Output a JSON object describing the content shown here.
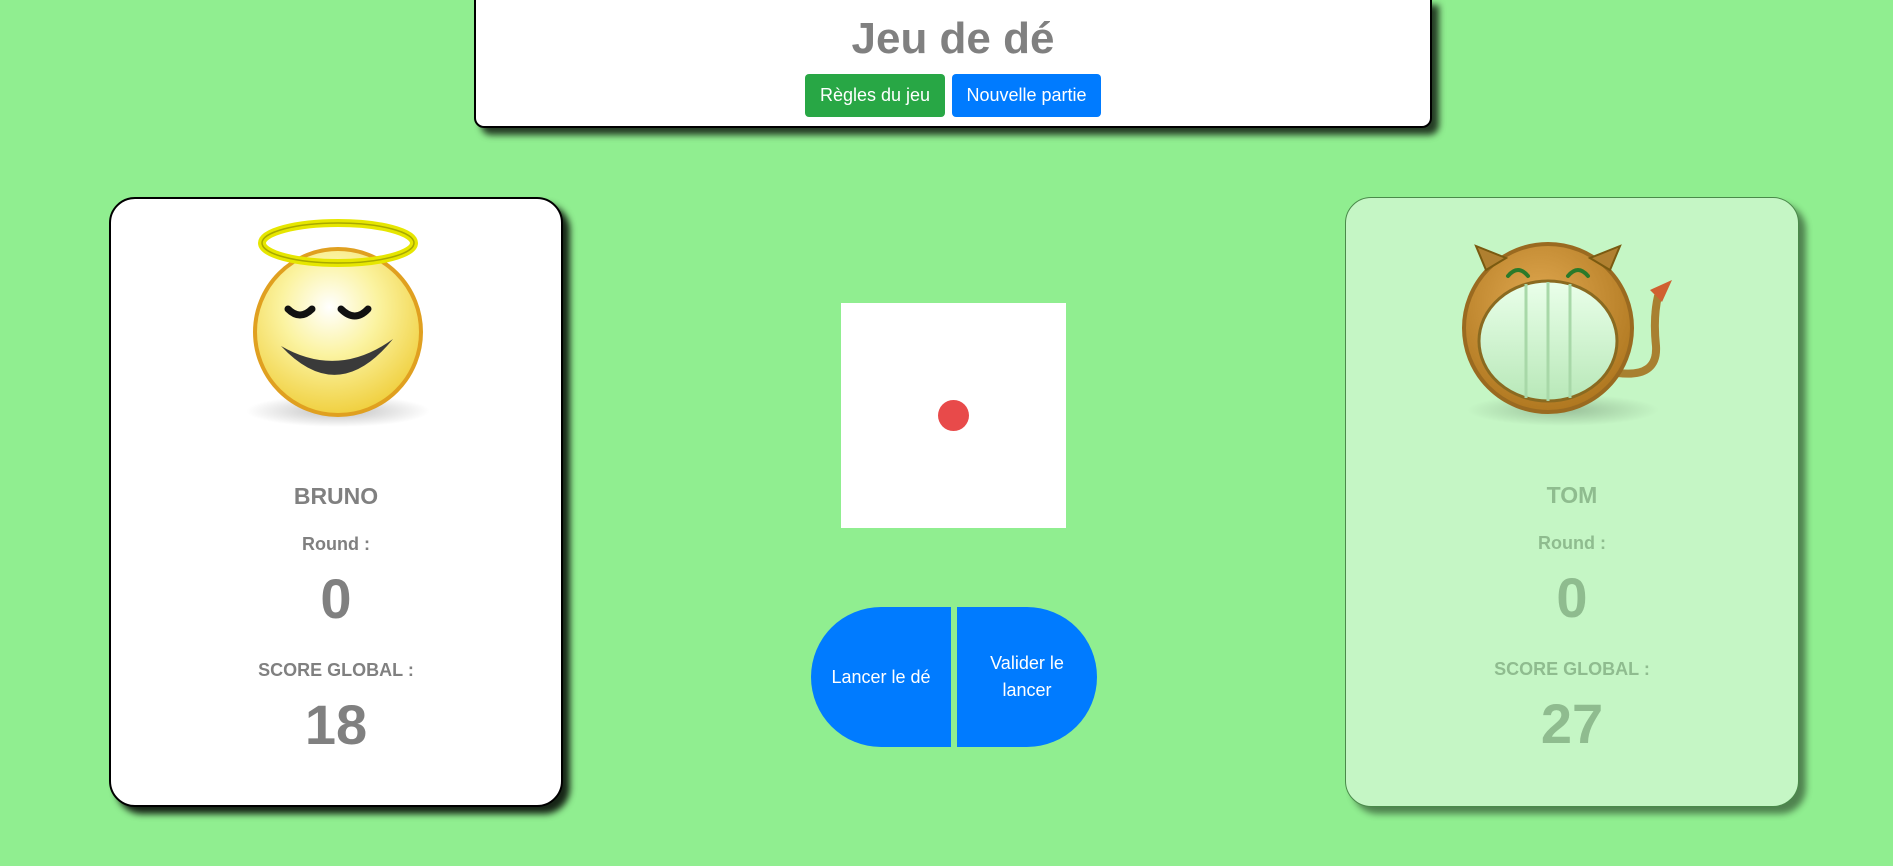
{
  "header": {
    "title": "Jeu de dé",
    "rules_button": "Règles du jeu",
    "new_game_button": "Nouvelle partie"
  },
  "players": [
    {
      "name": "BRUNO",
      "avatar": "angel-smiley-icon",
      "round_label": "Round :",
      "round_score": "0",
      "global_label": "SCORE GLOBAL :",
      "global_score": "18",
      "active": true
    },
    {
      "name": "TOM",
      "avatar": "devil-smiley-icon",
      "round_label": "Round :",
      "round_score": "0",
      "global_label": "SCORE GLOBAL :",
      "global_score": "27",
      "active": false
    }
  ],
  "die": {
    "face": 1,
    "pip_color": "#e84a4a"
  },
  "actions": {
    "roll_label": "Lancer le dé",
    "hold_label": "Valider le lancer"
  },
  "colors": {
    "background": "#90ee90",
    "primary": "#007bff",
    "success": "#28a745",
    "inactive_card": "#c5f6c5"
  }
}
